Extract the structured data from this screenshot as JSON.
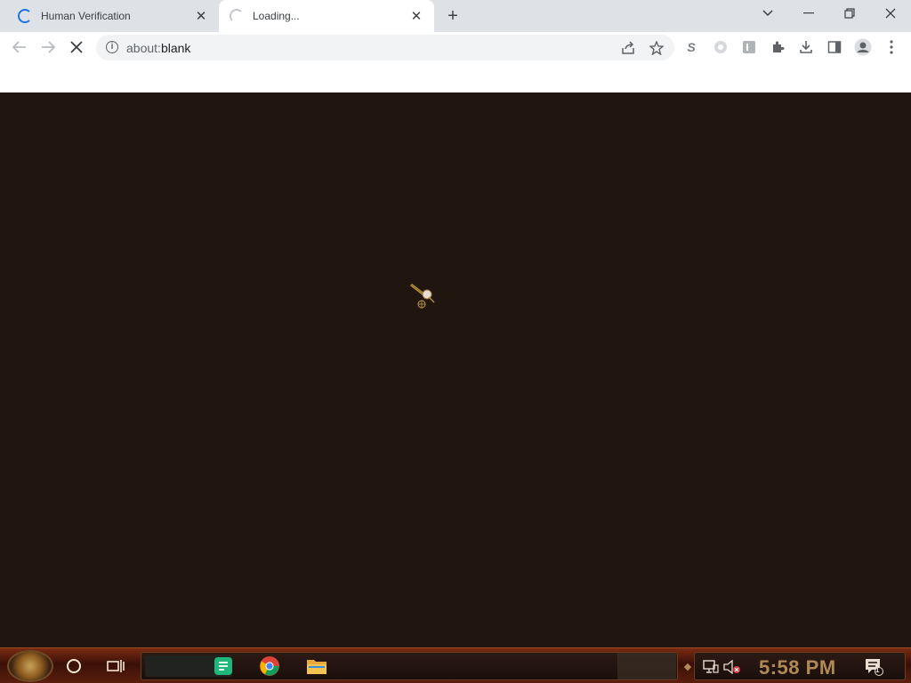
{
  "browser": {
    "tabs": [
      {
        "title": "Human Verification",
        "state": "loading"
      },
      {
        "title": "Loading...",
        "state": "loading"
      }
    ],
    "active_tab_index": 1,
    "address_bar": {
      "scheme": "about:",
      "path": "blank"
    }
  },
  "taskbar": {
    "clock": "5:58 PM",
    "pinned_apps": [
      "notes-app",
      "chrome",
      "file-explorer"
    ],
    "notification_count": "1"
  },
  "colors": {
    "page_background": "#20160f",
    "tab_strip": "#dee1e6",
    "taskbar": "#5a1e0c",
    "clock_text": "#b08a55"
  }
}
